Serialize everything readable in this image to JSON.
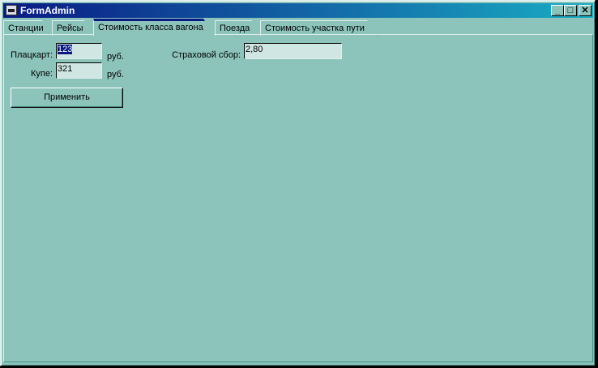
{
  "window": {
    "title": "FormAdmin",
    "minimize": "_",
    "maximize": "□",
    "close": "✕"
  },
  "tabs": [
    {
      "label": "Станции",
      "active": false
    },
    {
      "label": "Рейсы",
      "active": false
    },
    {
      "label": "Стоимость класса вагона",
      "active": true
    },
    {
      "label": "Поезда",
      "active": false
    },
    {
      "label": "Стоимость участка пути",
      "active": false
    }
  ],
  "form": {
    "platskart_label": "Плацкарт:",
    "platskart_value": "123",
    "kupe_label": "Купе:",
    "kupe_value": "321",
    "currency": "руб.",
    "insurance_label": "Страховой сбор:",
    "insurance_value": "2,80",
    "apply_label": "Применить"
  }
}
